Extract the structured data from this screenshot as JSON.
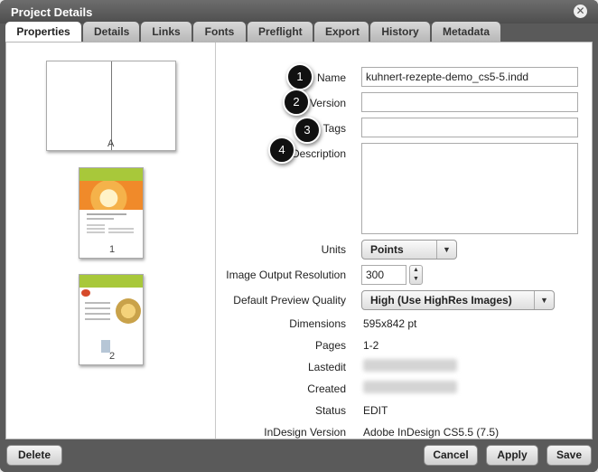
{
  "dialog": {
    "title": "Project Details",
    "close_icon": "close-icon"
  },
  "tabs": [
    {
      "label": "Properties",
      "active": true
    },
    {
      "label": "Details"
    },
    {
      "label": "Links"
    },
    {
      "label": "Fonts"
    },
    {
      "label": "Preflight"
    },
    {
      "label": "Export"
    },
    {
      "label": "History"
    },
    {
      "label": "Metadata"
    }
  ],
  "thumbnails": [
    {
      "label": "A"
    },
    {
      "label": "1"
    },
    {
      "label": "2"
    }
  ],
  "callouts": [
    "1",
    "2",
    "3",
    "4"
  ],
  "form": {
    "name_label": "Name",
    "name_value": "kuhnert-rezepte-demo_cs5-5.indd",
    "version_label": "Version",
    "version_value": "",
    "tags_label": "Tags",
    "tags_value": "",
    "description_label": "Description",
    "description_value": "",
    "units_label": "Units",
    "units_value": "Points",
    "resolution_label": "Image Output Resolution",
    "resolution_value": "300",
    "preview_label": "Default Preview Quality",
    "preview_value": "High (Use HighRes Images)",
    "dimensions_label": "Dimensions",
    "dimensions_value": "595x842 pt",
    "pages_label": "Pages",
    "pages_value": "1-2",
    "lastedit_label": "Lastedit",
    "lastedit_value": "",
    "created_label": "Created",
    "created_value": "",
    "status_label": "Status",
    "status_value": "EDIT",
    "indesign_label": "InDesign Version",
    "indesign_value": "Adobe InDesign CS5.5 (7.5)"
  },
  "buttons": {
    "delete": "Delete",
    "cancel": "Cancel",
    "apply": "Apply",
    "save": "Save"
  },
  "colors": {
    "accent_green": "#a8c83a",
    "dialog_frame": "#5a5a5a"
  }
}
